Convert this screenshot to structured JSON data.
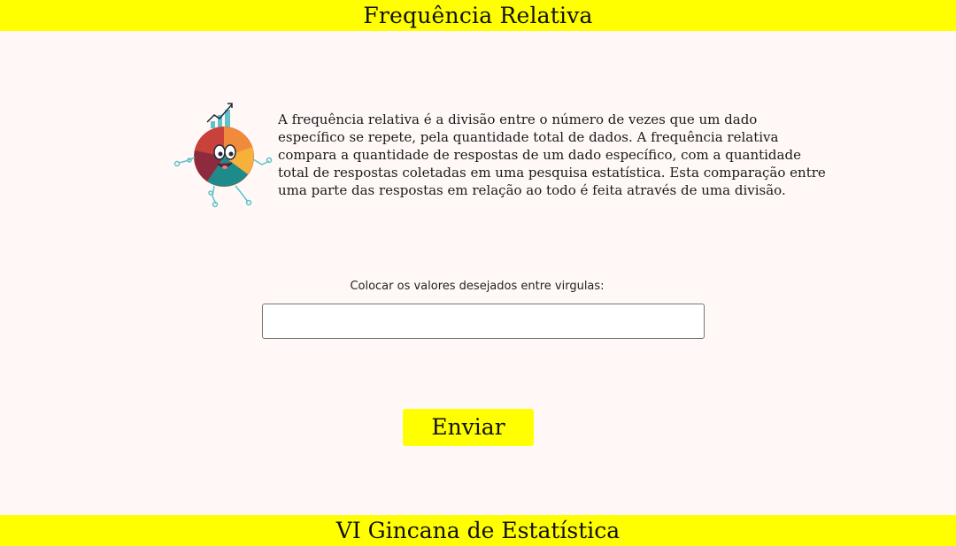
{
  "header": {
    "title": "Frequência Relativa"
  },
  "intro": {
    "text": "A frequência relativa é a divisão entre o número de vezes que um dado específico se repete, pela quantidade total de dados. A frequência relativa compara a quantidade de respostas de um dado específico, com a quantidade total de respostas coletadas em uma pesquisa estatística. Esta comparação entre uma parte das respostas em relação ao todo é feita através de uma divisão."
  },
  "form": {
    "label": "Colocar os valores desejados entre virgulas:",
    "input_value": "",
    "input_placeholder": "",
    "submit_label": "Enviar"
  },
  "footer": {
    "text": "VI Gincana de Estatística"
  },
  "colors": {
    "bar_yellow": "#ffff00",
    "background": "#fff8f6"
  },
  "icons": {
    "mascot": "pie-chart-mascot-icon"
  }
}
